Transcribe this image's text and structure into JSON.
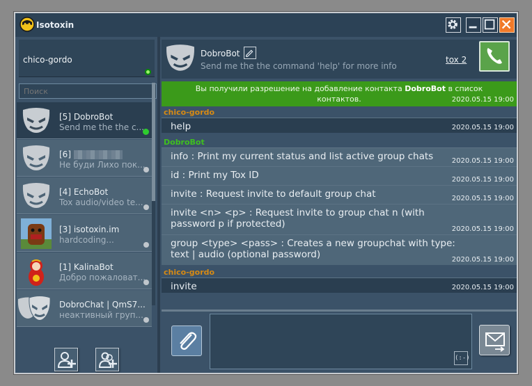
{
  "app": {
    "title": "Isotoxin"
  },
  "self": {
    "name": "chico-gordo",
    "status_color": "#9cf06a"
  },
  "search": {
    "placeholder": "Поиск"
  },
  "contacts": [
    {
      "name": "[5] DobroBot",
      "sub": "Send me the the c...",
      "online": true,
      "avatar": "tox-mask-icon",
      "selected": true
    },
    {
      "name": "[6]",
      "sub": "Не буди Лихо пок...",
      "online": false,
      "avatar": "tox-mask-icon",
      "name_redacted": true
    },
    {
      "name": "[4] EchoBot",
      "sub": "Tox audio/video te...",
      "online": false,
      "avatar": "tox-mask-icon"
    },
    {
      "name": "[3] isotoxin.im",
      "sub": "hardcoding...",
      "online": false,
      "avatar": "domo-avatar-icon"
    },
    {
      "name": "[1] KalinaBot",
      "sub": "Добро пожаловат...",
      "online": false,
      "avatar": "matryoshka-avatar-icon"
    },
    {
      "name": "DobroChat | QmS7...",
      "sub": "неактивный груп...",
      "online": false,
      "avatar": "group-mask-icon"
    }
  ],
  "chat_header": {
    "name": "DobroBot",
    "status": "Send me the the command 'help' for more info",
    "protocol": "tox 2"
  },
  "system_message": {
    "prefix": "Вы получили разрешение на добавление контакта ",
    "contact": "DobroBot",
    "suffix": " в список контактов.",
    "time": "2020.05.15 19:00"
  },
  "messages": [
    {
      "sender": "chico-gordo",
      "is_self": true,
      "text": "help",
      "time": "2020.05.15 19:00"
    },
    {
      "sender": "DobroBot",
      "is_self": false,
      "text": "info : Print my current status and list active group chats",
      "time": "2020.05.15 19:00"
    },
    {
      "sender": "",
      "is_self": false,
      "text": "id : Print my Tox ID",
      "time": "2020.05.15 19:00"
    },
    {
      "sender": "",
      "is_self": false,
      "text": "invite : Request invite to default group chat",
      "time": "2020.05.15 19:00"
    },
    {
      "sender": "",
      "is_self": false,
      "text": "invite <n> <p> : Request invite to group chat n (with password p if protected)",
      "time": "2020.05.15 19:00"
    },
    {
      "sender": "",
      "is_self": false,
      "text": "group <type> <pass> : Creates a new groupchat with type: text | audio (optional password)",
      "time": "2020.05.15 19:00"
    },
    {
      "sender": "chico-gordo",
      "is_self": true,
      "text": "invite",
      "time": "2020.05.15 19:00"
    }
  ],
  "composer": {
    "smiley": "(:-)"
  },
  "colors": {
    "accent_green": "#3b9a1a",
    "self_sender": "#d68a14",
    "bot_sender": "#3fbf1f",
    "close_button": "#f07a2a"
  }
}
